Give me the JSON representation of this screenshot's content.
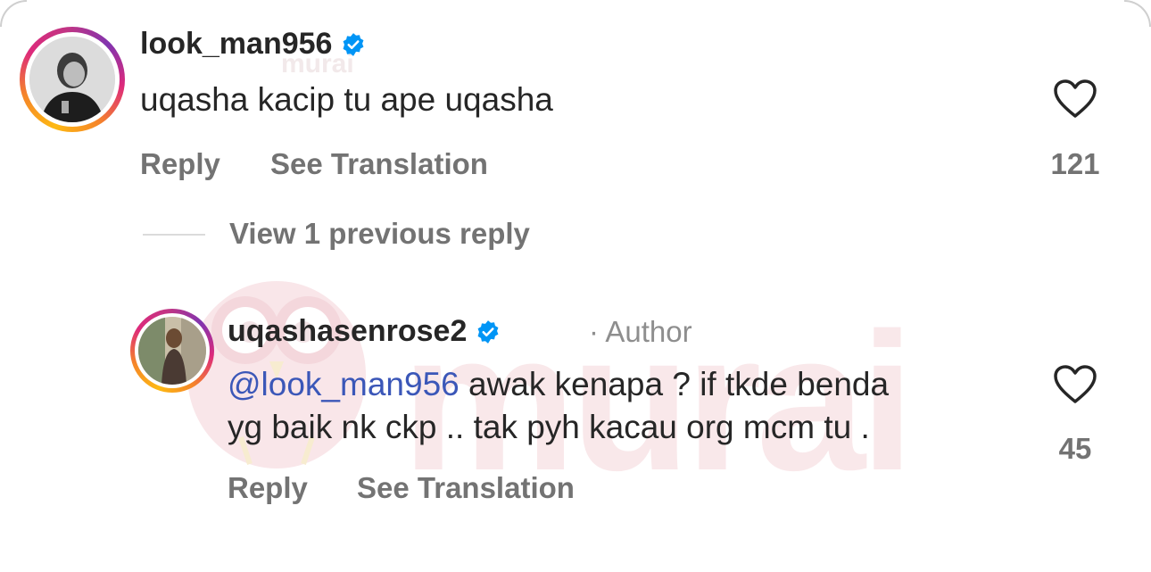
{
  "watermark": {
    "text": "murai",
    "small_text": "murai"
  },
  "comments": [
    {
      "username": "look_man956",
      "verified": true,
      "text": "uqasha kacip tu ape uqasha",
      "actions": {
        "reply": "Reply",
        "translate": "See Translation"
      },
      "like_count": "121"
    }
  ],
  "view_replies": "View 1 previous reply",
  "reply": {
    "username": "uqashasenrose2",
    "verified": true,
    "author_tag": "· Author",
    "mention": "@look_man956",
    "text_line1": " awak kenapa ? if tkde benda",
    "text_line2": "yg baik nk ckp .. tak pyh kacau org mcm tu .",
    "actions": {
      "reply": "Reply",
      "translate": "See Translation"
    },
    "like_count": "45"
  },
  "icons": {
    "verified": "verified-badge-icon",
    "like": "heart-icon"
  },
  "colors": {
    "verified": "#0095f6",
    "mention": "#3b57b8",
    "secondary_text": "#737373"
  }
}
